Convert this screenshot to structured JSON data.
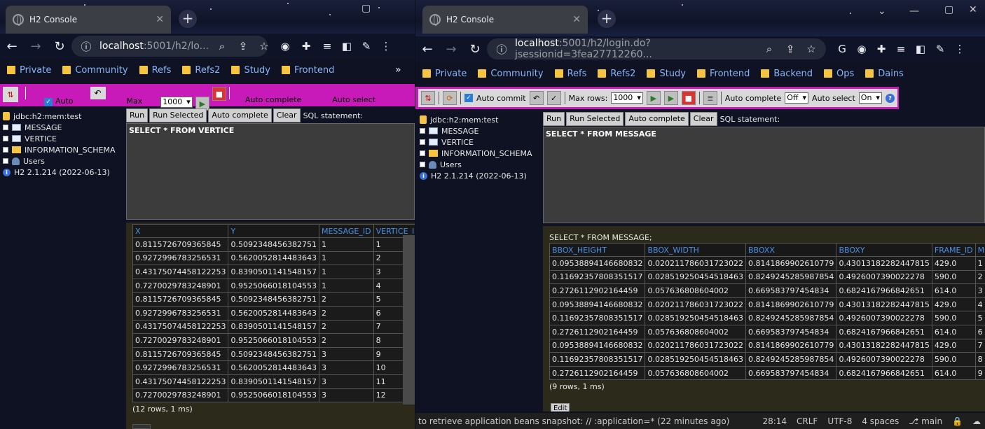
{
  "browser": {
    "tab_title": "H2 Console",
    "left": {
      "url_host": "localhost",
      "url_path": ":5001/h2/lo..."
    },
    "right": {
      "url_host": "localhost",
      "url_path": ":5001/h2/login.do?jsessionid=3fea27712260..."
    },
    "bookmarks_left": [
      "Private",
      "Community",
      "Refs",
      "Refs2",
      "Study",
      "Frontend"
    ],
    "bookmarks_right": [
      "Private",
      "Community",
      "Refs",
      "Refs2",
      "Study",
      "Frontend",
      "Backend",
      "Ops",
      "Dains"
    ],
    "more_bookmarks": "»"
  },
  "toolbar": {
    "auto_commit": "Auto commit",
    "auto_commit_short": "Auto",
    "max_rows": "Max rows:",
    "max_short": "Max",
    "max_rows_value": "1000",
    "auto_complete": "Auto complete",
    "auto_complete_value": "Off",
    "auto_select": "Auto select",
    "auto_select_value": "On"
  },
  "tree": {
    "db": "jdbc:h2:mem:test",
    "items": [
      "MESSAGE",
      "VERTICE",
      "INFORMATION_SCHEMA",
      "Users"
    ],
    "version": "H2 2.1.214 (2022-06-13)"
  },
  "query_buttons": {
    "run": "Run",
    "run_selected": "Run Selected",
    "auto_complete": "Auto complete",
    "clear": "Clear",
    "sql_statement": "SQL statement:"
  },
  "left_query": {
    "sql": "SELECT * FROM VERTICE",
    "columns": [
      "X",
      "Y",
      "MESSAGE_ID",
      "VERTICE_ID"
    ],
    "rows": [
      [
        "0.8115726709365845",
        "0.5092348456382751",
        "1",
        "1"
      ],
      [
        "0.9272996783256531",
        "0.5620052814483643",
        "1",
        "2"
      ],
      [
        "0.43175074458122253",
        "0.8390501141548157",
        "1",
        "3"
      ],
      [
        "0.7270029783248901",
        "0.9525066018104553",
        "1",
        "4"
      ],
      [
        "0.8115726709365845",
        "0.5092348456382751",
        "2",
        "5"
      ],
      [
        "0.9272996783256531",
        "0.5620052814483643",
        "2",
        "6"
      ],
      [
        "0.43175074458122253",
        "0.8390501141548157",
        "2",
        "7"
      ],
      [
        "0.7270029783248901",
        "0.9525066018104553",
        "2",
        "8"
      ],
      [
        "0.8115726709365845",
        "0.5092348456382751",
        "3",
        "9"
      ],
      [
        "0.9272996783256531",
        "0.5620052814483643",
        "3",
        "10"
      ],
      [
        "0.43175074458122253",
        "0.8390501141548157",
        "3",
        "11"
      ],
      [
        "0.7270029783248901",
        "0.9525066018104553",
        "3",
        "12"
      ]
    ],
    "info": "(12 rows, 1 ms)"
  },
  "right_query": {
    "sql": "SELECT * FROM MESSAGE",
    "echo": "SELECT * FROM MESSAGE;",
    "columns": [
      "BBOX_HEIGHT",
      "BBOX_WIDTH",
      "BBOXX",
      "BBOXY",
      "FRAME_ID",
      "MESSAGE_ID"
    ],
    "rows": [
      [
        "0.09538894146680832",
        "0.020211786031723022",
        "0.8141869902610779",
        "0.43013182282447815",
        "429.0",
        "1"
      ],
      [
        "0.11692357808351517",
        "0.028519250454518463",
        "0.8249245285987854",
        "0.4926007390022278",
        "590.0",
        "2"
      ],
      [
        "0.2726112902164459",
        "0.057636808604002",
        "0.669583797454834",
        "0.6824167966842651",
        "614.0",
        "3"
      ],
      [
        "0.09538894146680832",
        "0.020211786031723022",
        "0.8141869902610779",
        "0.43013182282447815",
        "429.0",
        "4"
      ],
      [
        "0.11692357808351517",
        "0.028519250454518463",
        "0.8249245285987854",
        "0.4926007390022278",
        "590.0",
        "5"
      ],
      [
        "0.2726112902164459",
        "0.057636808604002",
        "0.669583797454834",
        "0.6824167966842651",
        "614.0",
        "6"
      ],
      [
        "0.09538894146680832",
        "0.020211786031723022",
        "0.8141869902610779",
        "0.43013182282447815",
        "429.0",
        "7"
      ],
      [
        "0.11692357808351517",
        "0.028519250454518463",
        "0.8249245285987854",
        "0.4926007390022278",
        "590.0",
        "8"
      ],
      [
        "0.2726112902164459",
        "0.057636808604002",
        "0.669583797454834",
        "0.6824167966842651",
        "614.0",
        "9"
      ]
    ],
    "info": "(9 rows, 1 ms)",
    "edit": "Edit"
  },
  "statusbar": {
    "message": "to retrieve application beans snapshot: // :application=* (22 minutes ago)",
    "position": "28:14",
    "eol": "CRLF",
    "encoding": "UTF-8",
    "indent": "4 spaces",
    "branch": "main"
  }
}
